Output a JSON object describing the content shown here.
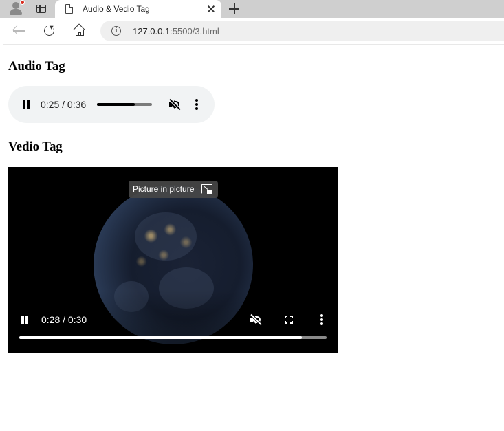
{
  "browser": {
    "tab": {
      "title": "Audio & Vedio Tag"
    },
    "address": {
      "host": "127.0.0.1",
      "rest": ":5500/3.html"
    }
  },
  "page": {
    "audio_heading": "Audio Tag",
    "video_heading": "Vedio Tag"
  },
  "audio_player": {
    "time": "0:25 / 0:36",
    "progress": 0.69,
    "muted": true
  },
  "video_player": {
    "time": "0:28 / 0:30",
    "progress": 0.92,
    "muted": true,
    "tooltip": "Picture in picture"
  },
  "icons": {
    "profile": "profile-avatar-icon",
    "tab_actions": "tab-actions-icon",
    "tab_page": "page-icon",
    "tab_close": "close-icon",
    "new_tab": "plus-icon",
    "back": "arrow-left-icon",
    "reload": "reload-icon",
    "home": "home-icon",
    "site_info": "info-icon",
    "pause": "pause-icon",
    "mute": "volume-muted-icon",
    "more": "kebab-menu-icon",
    "fullscreen": "fullscreen-icon",
    "pip": "picture-in-picture-icon"
  },
  "colors": {
    "tabstrip": "#cfcfcf",
    "omnibox": "#efefef",
    "audio_bg": "#f1f3f4",
    "video_bg": "#000000",
    "notification_dot": "#d92d20"
  }
}
